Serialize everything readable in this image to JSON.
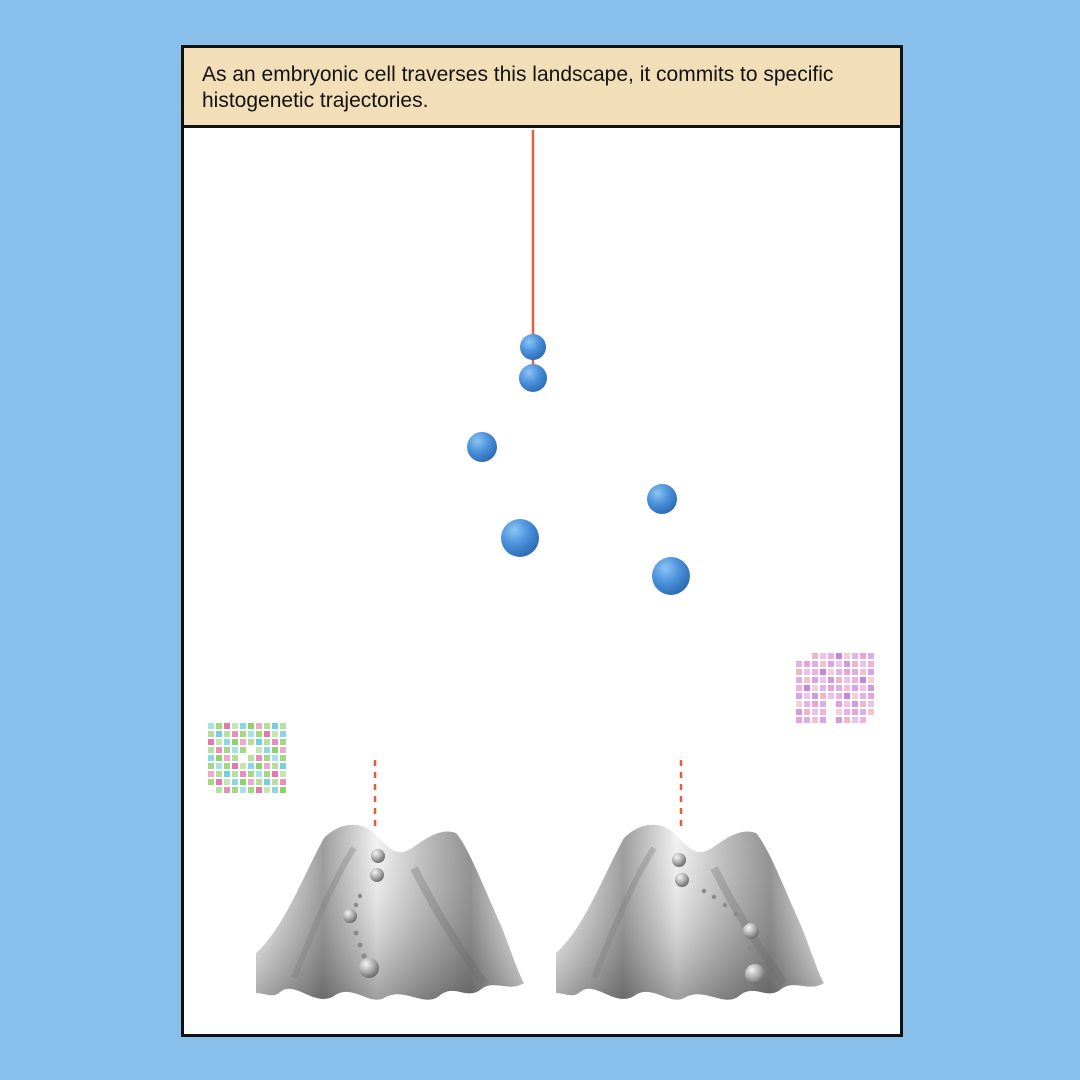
{
  "caption": {
    "text": "As an embryonic cell traverses this landscape, it commits to specific histogenetic trajectories."
  },
  "colors": {
    "background": "#89bfeb",
    "caption_fill": "#f2dfb8",
    "cell_blue": "#4a90da",
    "trajectory_line": "#e06040",
    "landscape_gray": "#bdbdbd",
    "cluster_left": [
      "#5ac8d8",
      "#7acb4a",
      "#e060a0",
      "#9ad06a"
    ],
    "cluster_right": [
      "#e890d8",
      "#c070d0",
      "#f0a8b8",
      "#d890e0"
    ]
  },
  "figure": {
    "elements": [
      "trajectory-line",
      "cell-spheres",
      "epigenetic-landscape-left",
      "epigenetic-landscape-right",
      "gene-expression-cluster-left",
      "gene-expression-cluster-right"
    ]
  }
}
